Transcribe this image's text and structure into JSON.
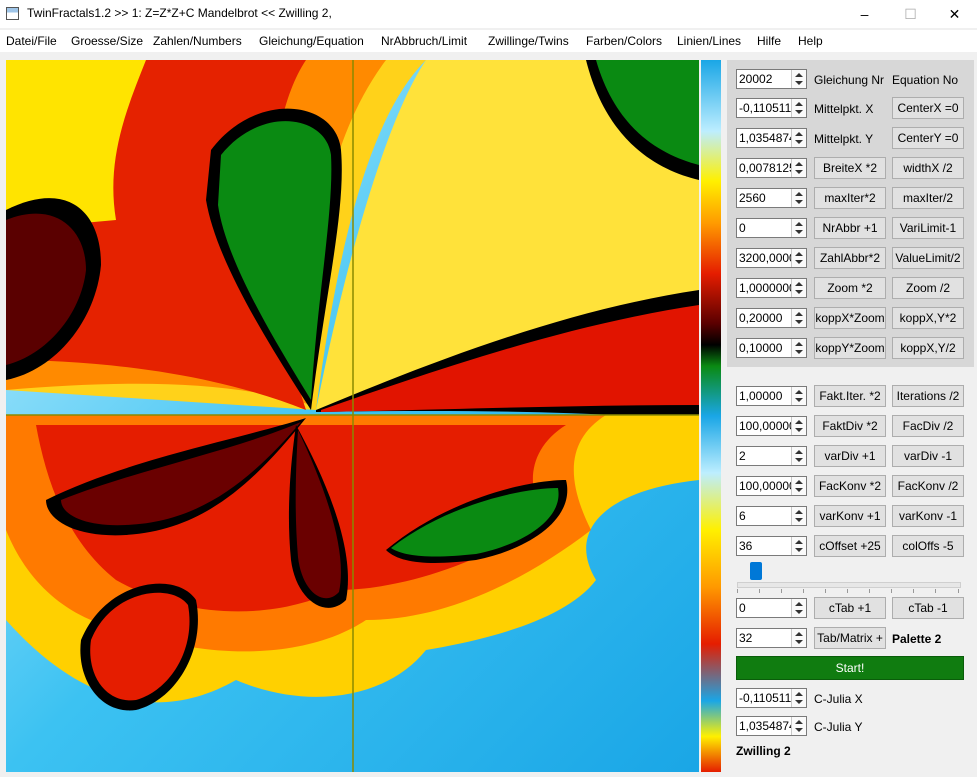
{
  "window": {
    "title": "TwinFractals1.2 >> 1: Z=Z*Z+C Mandelbrot << Zwilling 2,",
    "min": "–",
    "max": "☐",
    "close": "✕"
  },
  "menu": [
    "Datei/File",
    "Groesse/Size",
    "Zahlen/Numbers",
    "Gleichung/Equation",
    "NrAbbruch/Limit",
    "Zwillinge/Twins",
    "Farben/Colors",
    "Linien/Lines",
    "Hilfe",
    "Help"
  ],
  "top_panel": {
    "equation_value": "20002",
    "equation_label": "Gleichung Nr",
    "equation_no_label": "Equation No",
    "rows": [
      {
        "value": "-0,1105110(",
        "label": "Mittelpkt. X",
        "button": "CenterX =0"
      },
      {
        "value": "1,0354874(",
        "label": "Mittelpkt. Y",
        "button": "CenterY =0"
      },
      {
        "value": "0,0078125(",
        "button1": "BreiteX *2",
        "button2": "widthX /2"
      },
      {
        "value": "2560",
        "button1": "maxIter*2",
        "button2": "maxIter/2"
      },
      {
        "value": "0",
        "button1": "NrAbbr +1",
        "button2": "VariLimit-1"
      },
      {
        "value": "3200,0000",
        "button1": "ZahlAbbr*2",
        "button2": "ValueLimit/2"
      },
      {
        "value": "1,0000000",
        "button1": "Zoom *2",
        "button2": "Zoom /2"
      },
      {
        "value": "0,20000",
        "button1": "koppX*Zoom",
        "button2": "koppX,Y*2"
      },
      {
        "value": "0,10000",
        "button1": "koppY*Zoom",
        "button2": "koppX,Y/2"
      }
    ]
  },
  "bottom_panel": {
    "rows": [
      {
        "value": "1,00000",
        "button1": "Fakt.Iter. *2",
        "button2": "Iterations /2"
      },
      {
        "value": "100,00000",
        "button1": "FaktDiv *2",
        "button2": "FacDiv /2"
      },
      {
        "value": "2",
        "button1": "varDiv +1",
        "button2": "varDiv -1"
      },
      {
        "value": "100,00000",
        "button1": "FacKonv *2",
        "button2": "FacKonv /2"
      },
      {
        "value": "6",
        "button1": "varKonv +1",
        "button2": "varKonv -1"
      },
      {
        "value": "36",
        "button1": "cOffset +25",
        "button2": "colOffs -5"
      }
    ],
    "slider_level": 0.06,
    "ctab_value": "0",
    "ctab_plus": "cTab +1",
    "ctab_minus": "cTab -1",
    "tab_value": "32",
    "tab_button": "Tab/Matrix +",
    "palette_label": "Palette 2",
    "start_button": "Start!",
    "julia_x_value": "-0,1105110(",
    "julia_x_label": "C-Julia X",
    "julia_y_value": "1,0354874(",
    "julia_y_label": "C-Julia Y",
    "twin_label": "Zwilling 2"
  },
  "colors": {
    "start": "#107c10",
    "fractal_sky": "#2bb8f0",
    "fractal_red": "#e11400",
    "fractal_green": "#0a8a12",
    "crosshair": "#8a8a00"
  }
}
